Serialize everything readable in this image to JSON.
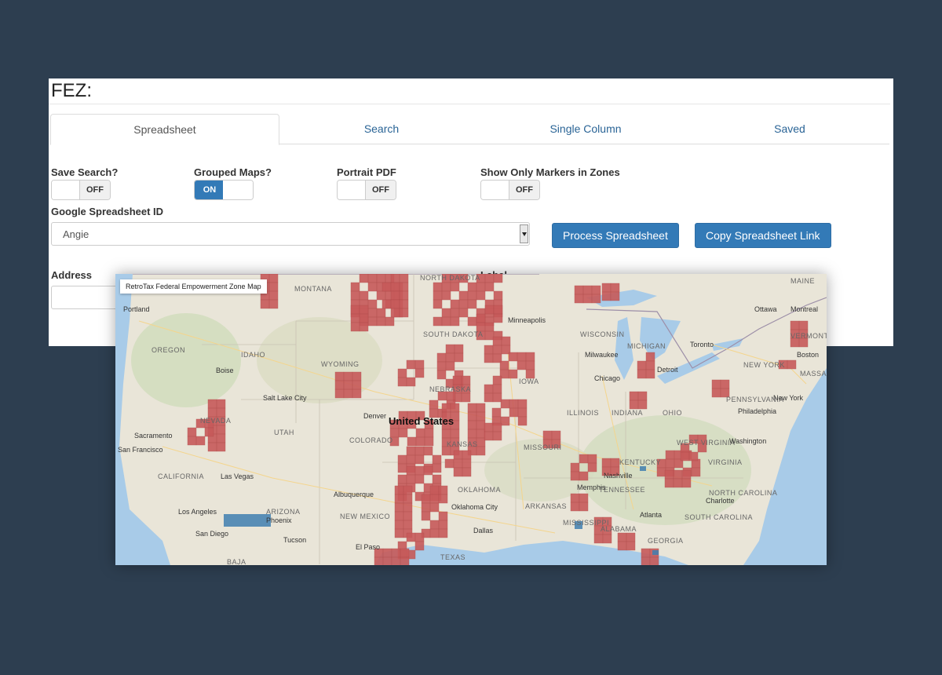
{
  "app": {
    "title": "FEZ:"
  },
  "tabs": [
    {
      "label": "Spreadsheet",
      "active": true
    },
    {
      "label": "Search",
      "active": false
    },
    {
      "label": "Single Column",
      "active": false
    },
    {
      "label": "Saved",
      "active": false
    }
  ],
  "toggles": {
    "save_search": {
      "label": "Save Search?",
      "state": "OFF"
    },
    "grouped_maps": {
      "label": "Grouped Maps?",
      "state": "ON"
    },
    "portrait_pdf": {
      "label": "Portrait PDF",
      "state": "OFF"
    },
    "markers_in_zones": {
      "label": "Show Only Markers in Zones",
      "state": "OFF"
    }
  },
  "spreadsheet": {
    "id_label": "Google Spreadsheet ID",
    "selected": "Angie",
    "process_button": "Process Spreadsheet",
    "copy_button": "Copy Spreadsheet Link"
  },
  "address": {
    "label": "Address",
    "hidden_label": "Label"
  },
  "map": {
    "title": "RetroTax Federal Empowerment Zone Map",
    "country_label": "United States",
    "zone_color": "#c75a5a",
    "marker_color": "#3f7fb0",
    "states": [
      "MONTANA",
      "NORTH DAKOTA",
      "SOUTH DAKOTA",
      "OREGON",
      "IDAHO",
      "WYOMING",
      "NEBRASKA",
      "IOWA",
      "NEVADA",
      "UTAH",
      "COLORADO",
      "KANSAS",
      "MISSOURI",
      "ILLINOIS",
      "INDIANA",
      "OHIO",
      "CALIFORNIA",
      "ARIZONA",
      "NEW MEXICO",
      "OKLAHOMA",
      "ARKANSAS",
      "TENNESSEE",
      "KENTUCKY",
      "VIRGINIA",
      "NORTH CAROLINA",
      "SOUTH CAROLINA",
      "GEORGIA",
      "MISSISSIPPI",
      "TEXAS",
      "MICHIGAN",
      "PENNSYLVANIA",
      "NEW YORK",
      "VERMONT",
      "MAINE",
      "BAJA",
      "WISCONSIN",
      "MASSACHUSETTS",
      "WEST VIRGINIA",
      "ALABAMA"
    ],
    "cities": [
      "Portland",
      "Minneapolis",
      "Milwaukee",
      "Toronto",
      "Ottawa",
      "Montreal",
      "Boise",
      "Detroit",
      "Chicago",
      "Salt Lake City",
      "Denver",
      "Sacramento",
      "San Francisco",
      "Las Vegas",
      "Los Angeles",
      "San Diego",
      "Phoenix",
      "Tucson",
      "Albuquerque",
      "El Paso",
      "Dallas",
      "Memphis",
      "Nashville",
      "Atlanta",
      "Charlotte",
      "Washington",
      "Philadelphia",
      "New York",
      "Boston",
      "Oklahoma City"
    ]
  }
}
